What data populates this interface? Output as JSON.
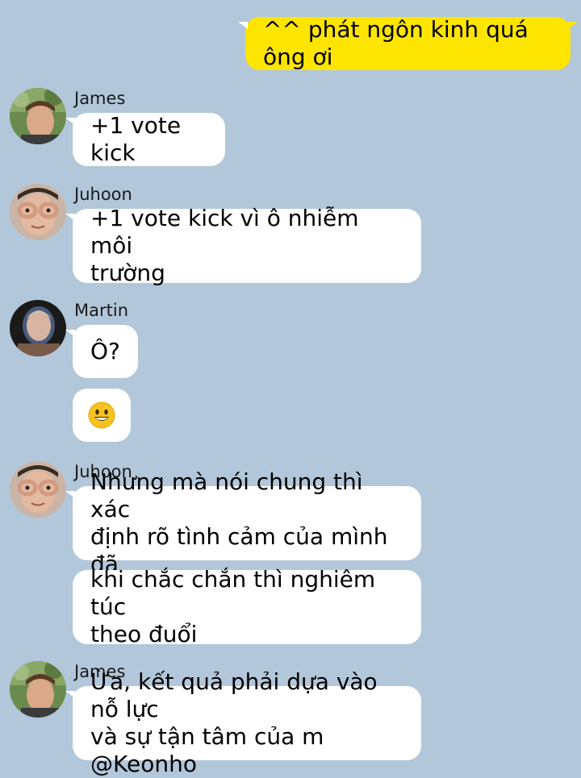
{
  "messages": [
    {
      "sender": "me",
      "text": "^^ phát ngôn kinh quá ông ơi"
    },
    {
      "sender": "James",
      "text": "+1 vote kick"
    },
    {
      "sender": "Juhoon",
      "text": "+1 vote kick vì ô nhiễm môi trường"
    },
    {
      "sender": "Martin",
      "text": "Ô?"
    },
    {
      "sender": "Martin",
      "emoji": "grinning-face-emoji"
    },
    {
      "sender": "Juhoon",
      "text": "Nhưng mà nói chung thì xác định rõ tình cảm của mình đã"
    },
    {
      "sender": "Juhoon",
      "text": "khi chắc chắn thì nghiêm túc theo đuổi"
    },
    {
      "sender": "James",
      "text": "Ừa, kết quả phải dựa vào nỗ lực và sự tận tâm của m @Keonho"
    }
  ],
  "names": {
    "james": "James",
    "juhoon": "Juhoon",
    "martin": "Martin"
  },
  "lines": {
    "m0": "^^ phát ngôn kinh quá ông ơi",
    "m1": "+1 vote kick",
    "m2a": "+1 vote kick vì ô nhiễm môi",
    "m2b": "trường",
    "m3": "Ô?",
    "m5a": "Nhưng mà nói chung thì xác",
    "m5b": "định rõ tình cảm của mình đã",
    "m6a": "khi chắc chắn thì nghiêm túc",
    "m6b": "theo đuổi",
    "m7a": "Ừa, kết quả phải dựa vào nỗ lực",
    "m7b": "và sự tận tâm của m @Keonho"
  },
  "colors": {
    "background": "#b2c7d9",
    "my_bubble": "#fee500",
    "other_bubble": "#ffffff"
  }
}
